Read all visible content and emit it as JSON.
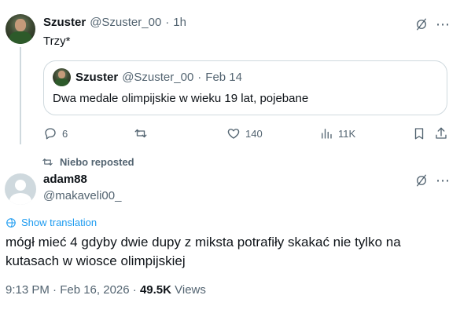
{
  "tweet": {
    "author_name": "Szuster",
    "author_handle": "@Szuster_00",
    "separator": "·",
    "time": "1h",
    "text": "Trzy*",
    "quote": {
      "author_name": "Szuster",
      "author_handle": "@Szuster_00",
      "separator": "·",
      "date": "Feb 14",
      "text": "Dwa medale olimpijskie w wieku 19 lat, pojebane"
    },
    "actions": {
      "replies": "6",
      "reposts": "",
      "likes": "140",
      "views": "11K"
    }
  },
  "repost": {
    "label": "Niebo reposted"
  },
  "main_post": {
    "author_name": "adam88",
    "author_handle": "@makaveli00_",
    "translation_link": "Show translation",
    "text_line1": "mógł mieć 4 gdyby dwie dupy z miksta potrafiły skakać nie tylko na",
    "text_line2": "kutasach w wiosce olimpijskiej",
    "timestamp": "9:13 PM · Feb 16, 2026 ·",
    "views_count": "49.5K",
    "views_label": "Views"
  },
  "icons": {
    "more": "grok-icon",
    "reply": "reply-icon",
    "repost": "repost-icon",
    "like": "heart-icon",
    "views": "views-icon",
    "bookmark": "bookmark-icon",
    "share": "share-icon",
    "translate": "globe-icon"
  },
  "colors": {
    "text": "#0f1419",
    "muted": "#536471",
    "link": "#1d9bf0",
    "border": "#cfd9de"
  }
}
